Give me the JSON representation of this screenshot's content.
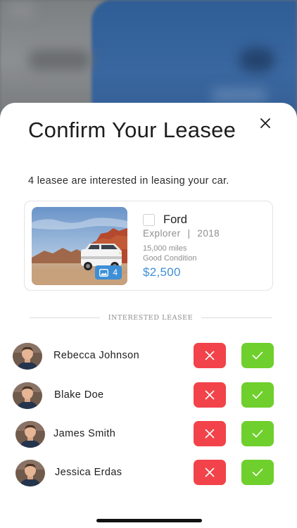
{
  "modal": {
    "title": "Confirm Your Leasee",
    "subtitle": "4 leasee are interested in leasing your car."
  },
  "car": {
    "make": "Ford",
    "model": "Explorer",
    "separator": "|",
    "year": "2018",
    "mileage": "15,000 miles",
    "condition": "Good Condition",
    "price": "$2,500",
    "photo_count": "4"
  },
  "section": {
    "label": "INTERESTED LEASEE"
  },
  "leasees": [
    {
      "name": "Rebecca Johnson"
    },
    {
      "name": "Blake Doe"
    },
    {
      "name": "James Smith"
    },
    {
      "name": "Jessica Erdas"
    }
  ],
  "colors": {
    "reject": "#f2434a",
    "accept": "#6fcf2c",
    "accent": "#3e8fd6"
  }
}
